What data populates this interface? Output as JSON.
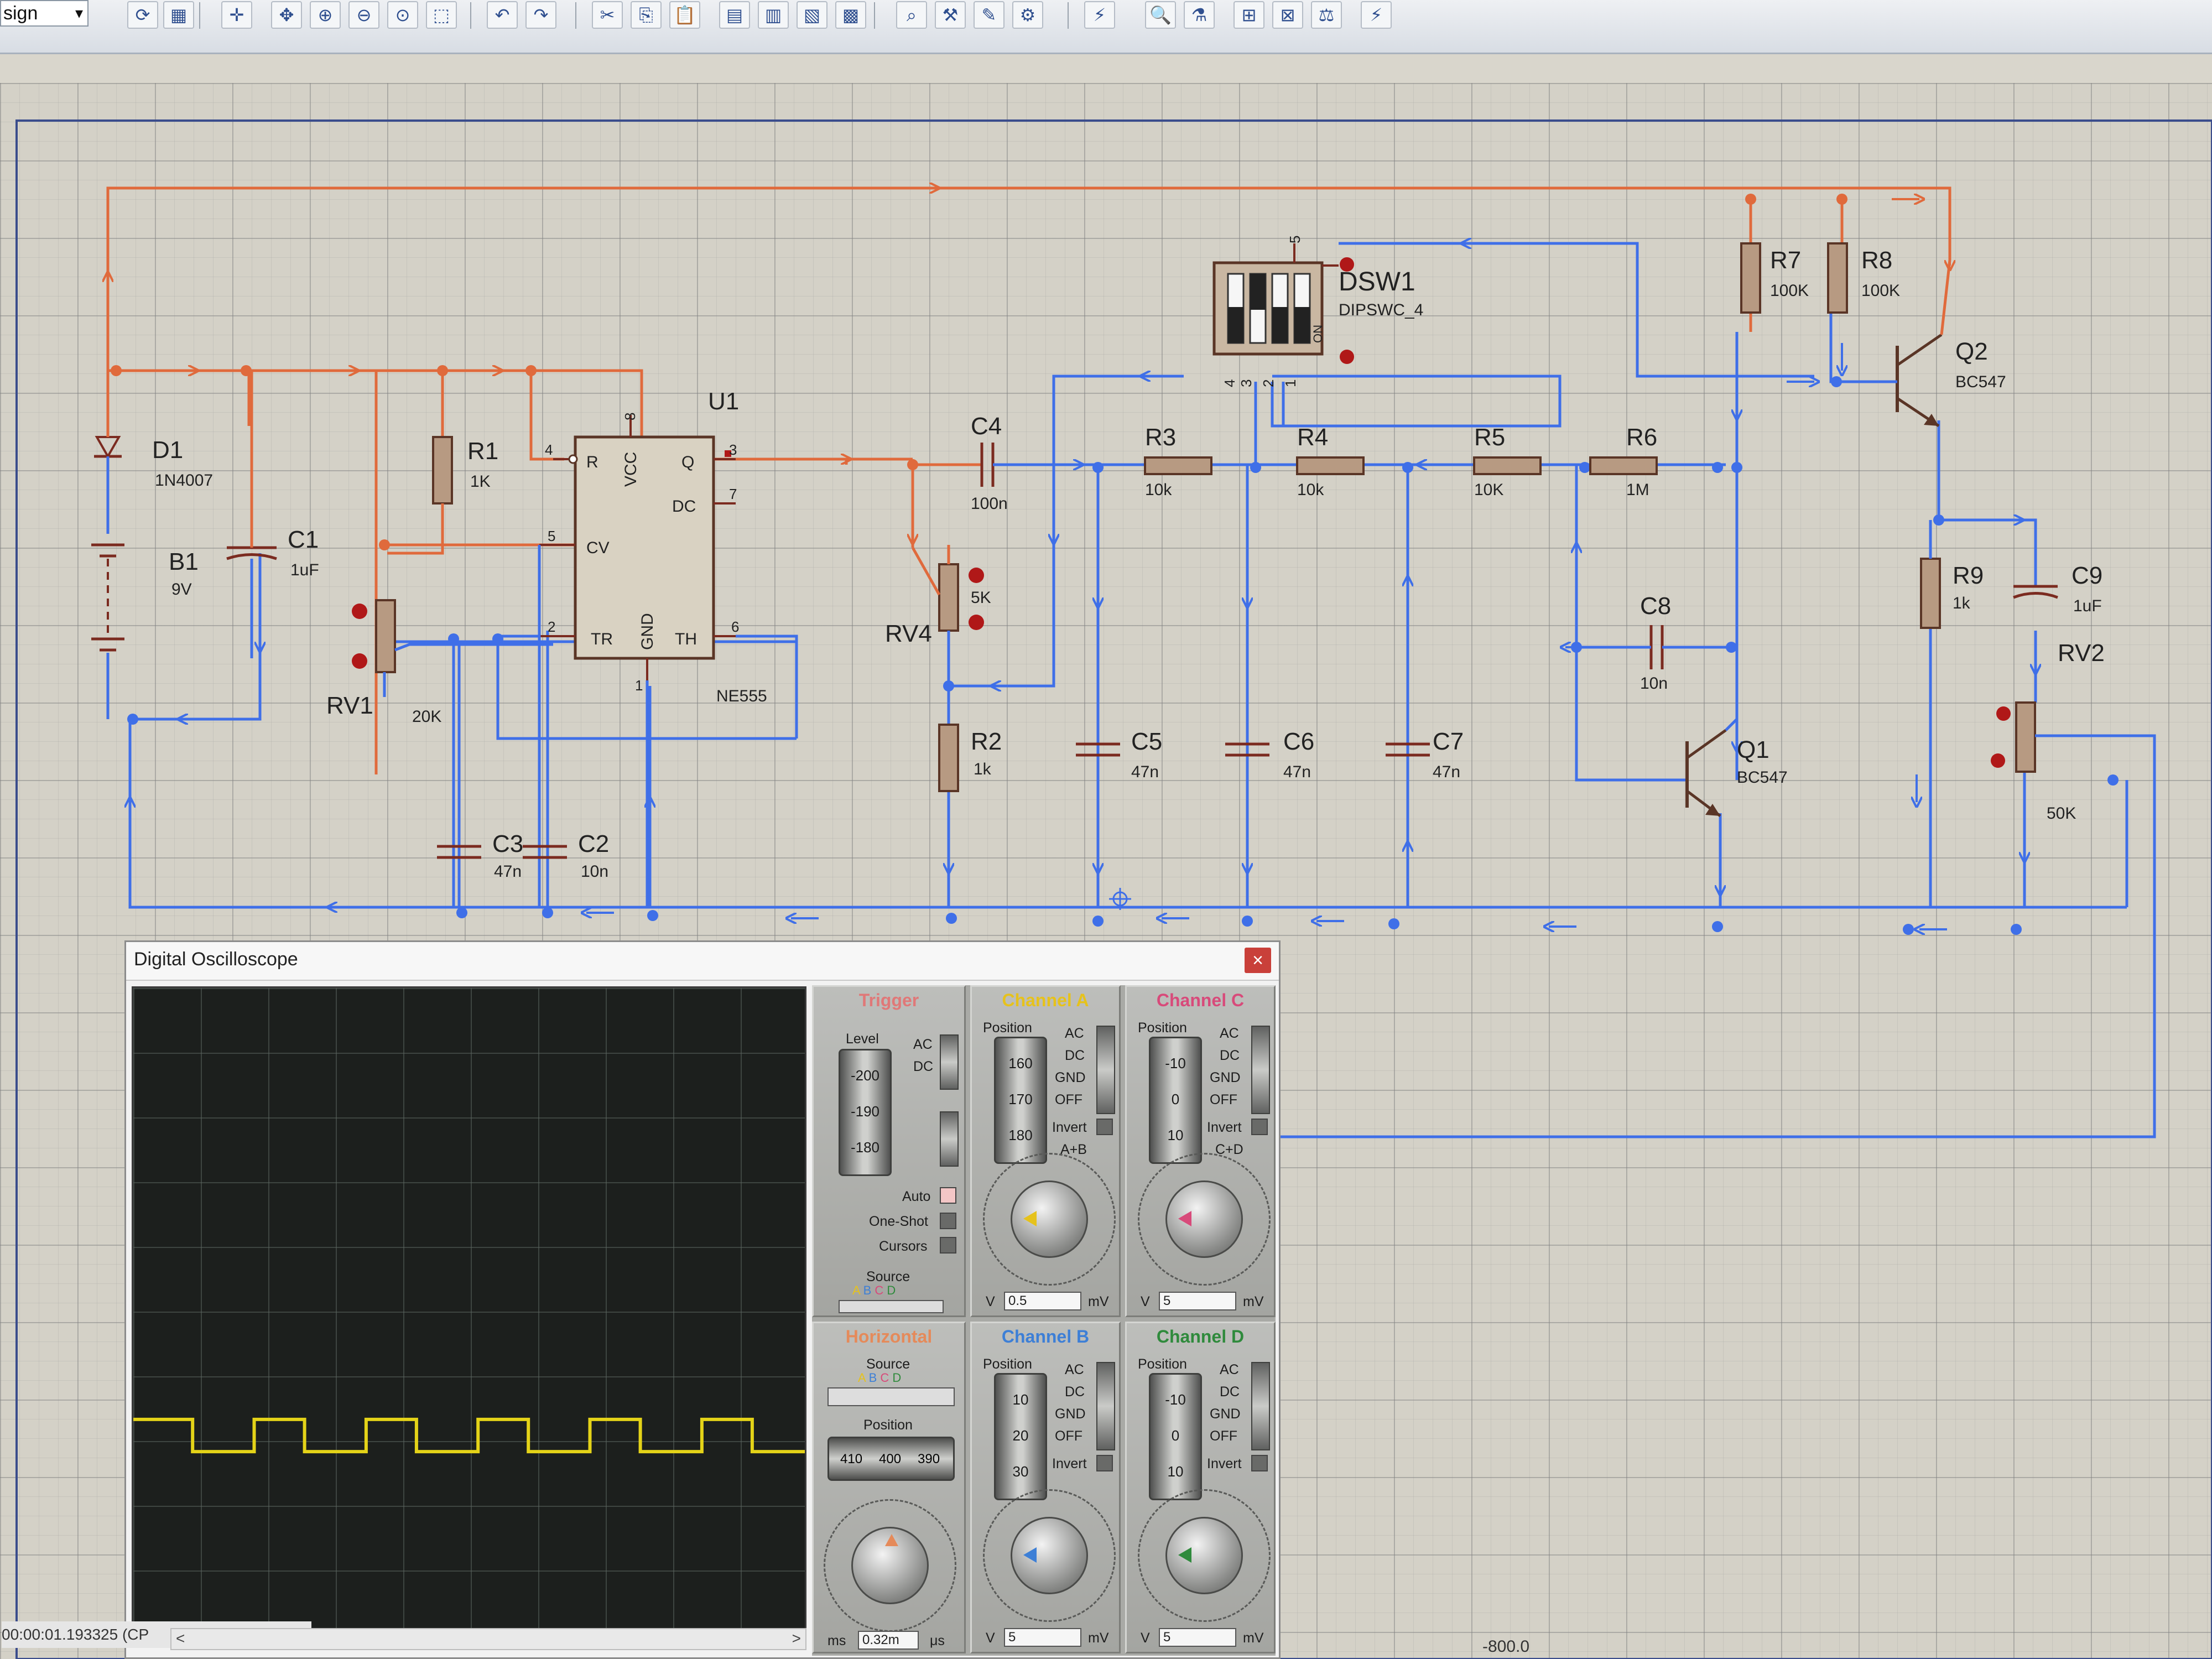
{
  "toolbar": {
    "mode_label": "sign",
    "mode_arrow": "▾",
    "buttons": [
      {
        "name": "refresh-icon",
        "glyph": "⟳"
      },
      {
        "name": "grid-icon",
        "glyph": "▦"
      },
      {
        "name": "origin-icon",
        "glyph": "✛"
      },
      {
        "name": "pan-icon",
        "glyph": "✥"
      },
      {
        "name": "zoom-in-icon",
        "glyph": "⊕"
      },
      {
        "name": "zoom-out-icon",
        "glyph": "⊖"
      },
      {
        "name": "zoom-all-icon",
        "glyph": "⊙"
      },
      {
        "name": "zoom-area-icon",
        "glyph": "⬚"
      },
      {
        "name": "undo-icon",
        "glyph": "↶"
      },
      {
        "name": "redo-icon",
        "glyph": "↷"
      },
      {
        "name": "cut-icon",
        "glyph": "✂"
      },
      {
        "name": "copy-icon",
        "glyph": "⎘"
      },
      {
        "name": "paste-icon",
        "glyph": "📋"
      },
      {
        "name": "block-copy-icon",
        "glyph": "▤"
      },
      {
        "name": "block-move-icon",
        "glyph": "▥"
      },
      {
        "name": "block-rotate-icon",
        "glyph": "▧"
      },
      {
        "name": "block-delete-icon",
        "glyph": "▩"
      },
      {
        "name": "pick-device-icon",
        "glyph": "⌕"
      },
      {
        "name": "make-device-icon",
        "glyph": "⚒"
      },
      {
        "name": "package-icon",
        "glyph": "✎"
      },
      {
        "name": "decompose-icon",
        "glyph": "⚙"
      },
      {
        "name": "wire-autorouter-icon",
        "glyph": "⚡"
      },
      {
        "name": "search-icon",
        "glyph": "🔍"
      },
      {
        "name": "property-tool-icon",
        "glyph": "⚗"
      },
      {
        "name": "new-sheet-icon",
        "glyph": "⊞"
      },
      {
        "name": "remove-sheet-icon",
        "glyph": "⊠"
      },
      {
        "name": "bom-icon",
        "glyph": "⚖"
      },
      {
        "name": "netlist-icon",
        "glyph": "⚡"
      }
    ]
  },
  "schematic": {
    "components": {
      "D1": {
        "ref": "D1",
        "value": "1N4007"
      },
      "B1": {
        "ref": "B1",
        "value": "9V"
      },
      "C1": {
        "ref": "C1",
        "value": "1uF"
      },
      "R1": {
        "ref": "R1",
        "value": "1K"
      },
      "RV1": {
        "ref": "RV1",
        "value": "20K"
      },
      "U1": {
        "ref": "U1",
        "value": "NE555"
      },
      "C3": {
        "ref": "C3",
        "value": "47n"
      },
      "C2": {
        "ref": "C2",
        "value": "10n"
      },
      "C4": {
        "ref": "C4",
        "value": "100n"
      },
      "RV4": {
        "ref": "RV4",
        "value": "5K"
      },
      "R2": {
        "ref": "R2",
        "value": "1k"
      },
      "R3": {
        "ref": "R3",
        "value": "10k"
      },
      "R4": {
        "ref": "R4",
        "value": "10k"
      },
      "R5": {
        "ref": "R5",
        "value": "10K"
      },
      "R6": {
        "ref": "R6",
        "value": "1M"
      },
      "C5": {
        "ref": "C5",
        "value": "47n"
      },
      "C6": {
        "ref": "C6",
        "value": "47n"
      },
      "C7": {
        "ref": "C7",
        "value": "47n"
      },
      "DSW1": {
        "ref": "DSW1",
        "value": "DIPSWC_4"
      },
      "R7": {
        "ref": "R7",
        "value": "100K"
      },
      "R8": {
        "ref": "R8",
        "value": "100K"
      },
      "Q2": {
        "ref": "Q2",
        "value": "BC547"
      },
      "C8": {
        "ref": "C8",
        "value": "10n"
      },
      "Q1": {
        "ref": "Q1",
        "value": "BC547"
      },
      "R9": {
        "ref": "R9",
        "value": "1k"
      },
      "C9": {
        "ref": "C9",
        "value": "1uF"
      },
      "RV2": {
        "ref": "RV2",
        "value": "50K"
      }
    },
    "u1_pins": {
      "R": "R",
      "VCC": "VCC",
      "Q": "Q",
      "DC": "DC",
      "CV": "CV",
      "TR": "TR",
      "GND": "GND",
      "TH": "TH",
      "n4": "4",
      "n8": "8",
      "n3": "3",
      "n7": "7",
      "n5": "5",
      "n2": "2",
      "n6": "6",
      "n1": "1"
    },
    "dsw_pins": {
      "n5": "5",
      "n4": "4",
      "n3": "3",
      "n2": "2",
      "n1": "1",
      "on": "ON"
    },
    "coordinate_readout": "-800.0"
  },
  "oscilloscope": {
    "title": "Digital Oscilloscope",
    "close_label": "×",
    "status_time": "00:00:01.193325 (CP",
    "scroll_left": "<",
    "scroll_right": ">",
    "trigger": {
      "title": "Trigger",
      "level_label": "Level",
      "level_ticks": [
        "-200",
        "-190",
        "-180"
      ],
      "ac": "AC",
      "dc": "DC",
      "auto": "Auto",
      "one_shot": "One-Shot",
      "cursors": "Cursors",
      "source_label": "Source",
      "source_channels": [
        "A",
        "B",
        "C",
        "D"
      ]
    },
    "horizontal": {
      "title": "Horizontal",
      "source_label": "Source",
      "source_channels": [
        "A",
        "B",
        "C",
        "D"
      ],
      "position_label": "Position",
      "position_ticks": [
        "410",
        "400",
        "390"
      ],
      "timebase_value": "0.32m",
      "unit_left": "ms",
      "unit_right": "μs"
    },
    "channels": [
      {
        "key": "A",
        "title": "Channel A",
        "color": "#e6c21c",
        "position_label": "Position",
        "ticks": [
          "160",
          "170",
          "180"
        ],
        "modes": [
          "AC",
          "DC",
          "GND",
          "OFF"
        ],
        "extra1": "Invert",
        "extra2": "A+B",
        "scale_value": "0.5",
        "unit_left": "V",
        "unit_right": "mV"
      },
      {
        "key": "C",
        "title": "Channel C",
        "color": "#d84a7a",
        "position_label": "Position",
        "ticks": [
          "-10",
          "0",
          "10"
        ],
        "modes": [
          "AC",
          "DC",
          "GND",
          "OFF"
        ],
        "extra1": "Invert",
        "extra2": "C+D",
        "scale_value": "5",
        "unit_left": "V",
        "unit_right": "mV"
      },
      {
        "key": "B",
        "title": "Channel B",
        "color": "#3d7fd6",
        "position_label": "Position",
        "ticks": [
          "10",
          "20",
          "30"
        ],
        "modes": [
          "AC",
          "DC",
          "GND",
          "OFF"
        ],
        "extra1": "Invert",
        "extra2": "",
        "scale_value": "5",
        "unit_left": "V",
        "unit_right": "mV"
      },
      {
        "key": "D",
        "title": "Channel D",
        "color": "#2f8a3c",
        "position_label": "Position",
        "ticks": [
          "-10",
          "0",
          "10"
        ],
        "modes": [
          "AC",
          "DC",
          "GND",
          "OFF"
        ],
        "extra1": "Invert",
        "extra2": "",
        "scale_value": "5",
        "unit_left": "V",
        "unit_right": "mV"
      }
    ],
    "colors": {
      "trace": "#e4d318",
      "trigger_title": "#e07878",
      "horizontal_title": "#e58a5a",
      "wire_red": "#e06a3c",
      "wire_blue": "#3f6fe8"
    },
    "trace": {
      "periods_visible": 6,
      "duty_high_fraction": 0.45,
      "baseline_fraction": 0.72,
      "amplitude_fraction": 0.025
    }
  }
}
